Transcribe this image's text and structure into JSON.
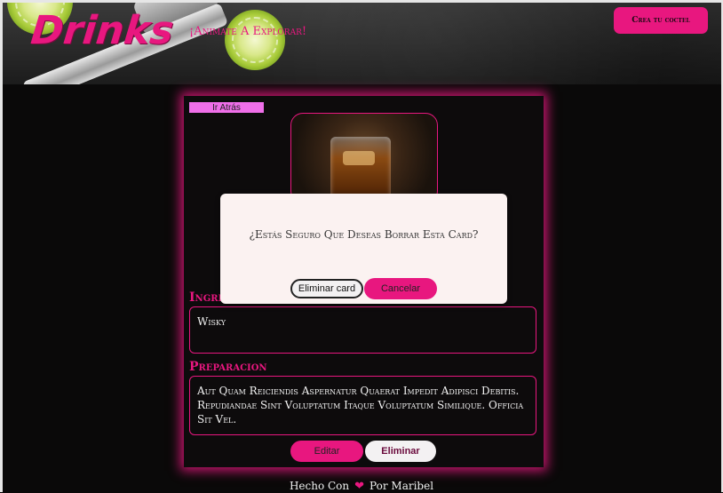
{
  "header": {
    "logo": "Drinks",
    "tagline": "¡Animate A Explorar!",
    "create_button": "Crea tu coctel"
  },
  "card": {
    "back_button": "Ir Atrás",
    "image_alt": "drink-photo",
    "ingredients_title": "Ingredientes",
    "ingredients_text": "Wisky",
    "preparation_title": "Preparacion",
    "preparation_text": "Aut Quam Reiciendis Aspernatur Quaerat Impedit Adipisci Debitis. Repudiandae Sint Voluptatum Itaque Voluptatum Similique. Officia Sit Vel.",
    "edit_button": "Editar",
    "delete_button": "Eliminar"
  },
  "modal": {
    "message": "¿Estás Seguro Que Deseas Borrar Esta Card?",
    "confirm_button": "Eliminar card",
    "cancel_button": "Cancelar"
  },
  "footer": {
    "made_with": "Hecho Con",
    "heart_icon": "heart-icon",
    "author": "Por Maribel"
  },
  "colors": {
    "accent": "#e8177f",
    "background": "#0a0909",
    "modal_bg": "#fbf2f1"
  }
}
